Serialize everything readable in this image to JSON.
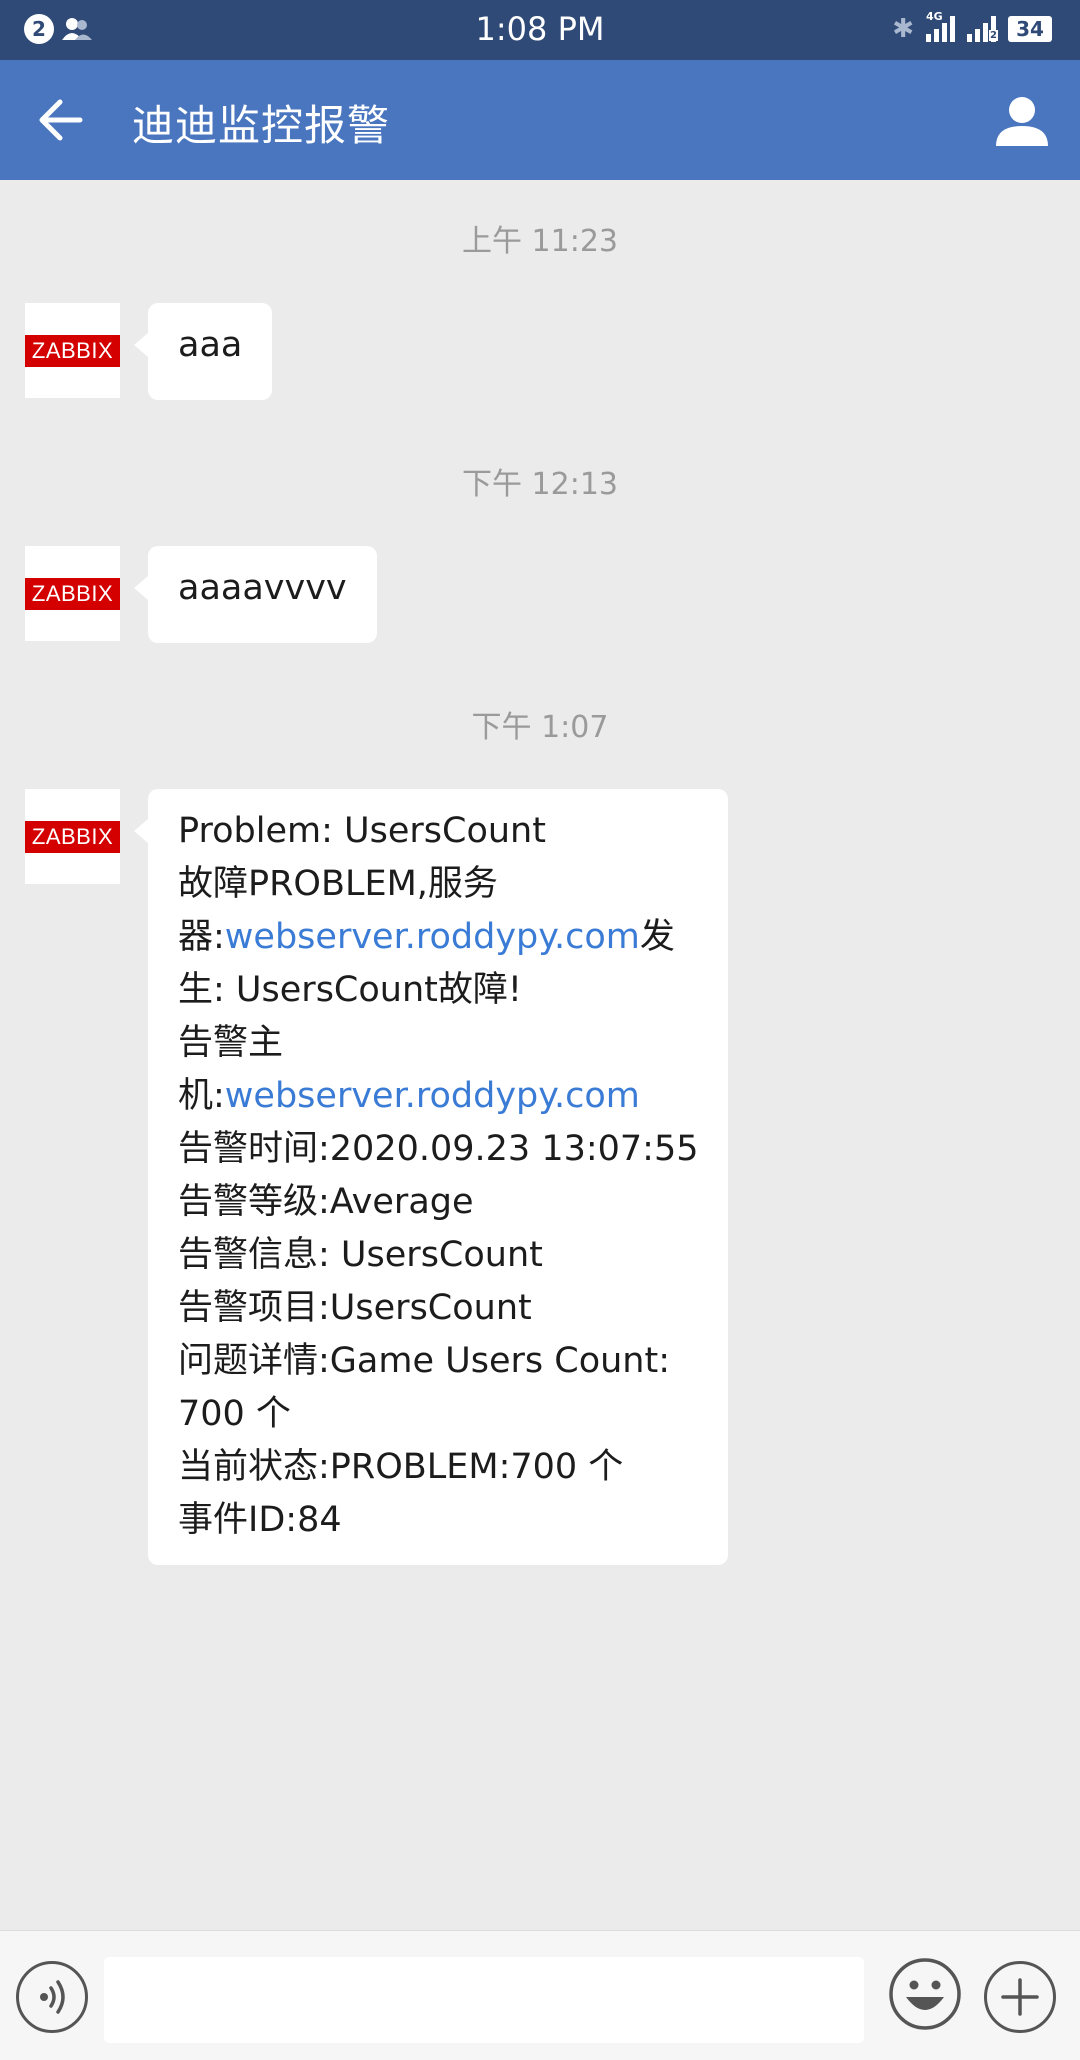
{
  "status_bar": {
    "notification_count": "2",
    "time": "1:08 PM",
    "network_type": "4G",
    "sim_slot": "2",
    "battery": "34"
  },
  "header": {
    "title": "迪迪监控报警"
  },
  "messages": [
    {
      "timestamp": "上午 11:23",
      "sender_logo": "ZABBIX",
      "text": "aaa"
    },
    {
      "timestamp": "下午 12:13",
      "sender_logo": "ZABBIX",
      "text": "aaaavvvv"
    },
    {
      "timestamp": "下午 1:07",
      "sender_logo": "ZABBIX",
      "lines": {
        "l1": "Problem: UsersCount",
        "l2": "故障PROBLEM,服务",
        "l3_pre": "器:",
        "l3_link": "webserver.roddypy.com",
        "l3_post": "发",
        "l4": "生: UsersCount故障!",
        "l5": "告警主",
        "l6_pre": "机:",
        "l6_link": "webserver.roddypy.com",
        "l7": "告警时间:2020.09.23 13:07:55",
        "l8": "告警等级:Average",
        "l9": "告警信息: UsersCount",
        "l10": "告警项目:UsersCount",
        "l11": "问题详情:Game Users Count:",
        "l12": "700 个",
        "l13": "当前状态:PROBLEM:700 个",
        "l14": "事件ID:84"
      }
    }
  ],
  "input_bar": {
    "value": "",
    "placeholder": ""
  },
  "colors": {
    "status_bar": "#2f4a76",
    "title_bar": "#4a76bf",
    "chat_bg": "#ebebeb",
    "link": "#3a7bd5",
    "zabbix_red": "#d40000"
  }
}
